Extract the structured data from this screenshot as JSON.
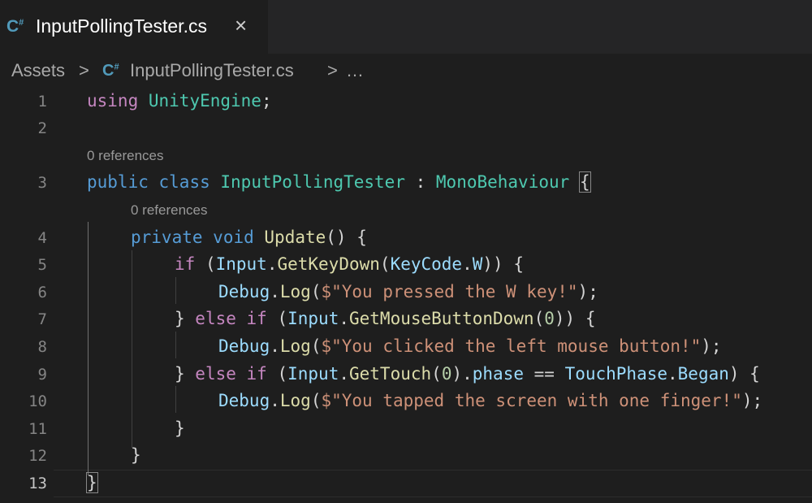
{
  "tab": {
    "icon": "csharp-icon",
    "title": "InputPollingTester.cs",
    "close": "×"
  },
  "breadcrumb": {
    "folder": "Assets",
    "sep1": ">",
    "file": "InputPollingTester.cs",
    "sep2": ">",
    "more": "…"
  },
  "editor": {
    "line_numbers": [
      "1",
      "2",
      "3",
      "4",
      "5",
      "6",
      "7",
      "8",
      "9",
      "10",
      "11",
      "12",
      "13"
    ],
    "active_line": "13",
    "codelens_class": "0 references",
    "codelens_method": "0 references",
    "code": {
      "l1_kw": "using",
      "l1_ns": "UnityEngine",
      "l1_semi": ";",
      "l3_public": "public",
      "l3_class": "class",
      "l3_name": "InputPollingTester",
      "l3_colon": " : ",
      "l3_base": "MonoBehaviour",
      "l3_brace": "{",
      "l4_private": "private",
      "l4_void": "void",
      "l4_method": "Update",
      "l4_rest": "() {",
      "l5_if": "if",
      "l5_open": " (",
      "l5_input": "Input",
      "l5_dot": ".",
      "l5_fn": "GetKeyDown",
      "l5_paren": "(",
      "l5_keycode": "KeyCode",
      "l5_dot2": ".",
      "l5_w": "W",
      "l5_close": ")) {",
      "l6_debug": "Debug",
      "l6_dot": ".",
      "l6_log": "Log",
      "l6_open": "(",
      "l6_str": "$\"You pressed the W key!\"",
      "l6_close": ");",
      "l7_brace": "} ",
      "l7_else": "else",
      "l7_sp": " ",
      "l7_if": "if",
      "l7_open": " (",
      "l7_input": "Input",
      "l7_dot": ".",
      "l7_fn": "GetMouseButtonDown",
      "l7_paren": "(",
      "l7_num": "0",
      "l7_close": ")) {",
      "l8_debug": "Debug",
      "l8_dot": ".",
      "l8_log": "Log",
      "l8_open": "(",
      "l8_str": "$\"You clicked the left mouse button!\"",
      "l8_close": ");",
      "l9_brace": "} ",
      "l9_else": "else",
      "l9_sp": " ",
      "l9_if": "if",
      "l9_open": " (",
      "l9_input": "Input",
      "l9_dot": ".",
      "l9_fn": "GetTouch",
      "l9_paren": "(",
      "l9_num": "0",
      "l9_rp": ").",
      "l9_phase": "phase",
      "l9_eq": " == ",
      "l9_tp": "TouchPhase",
      "l9_dot2": ".",
      "l9_began": "Began",
      "l9_close": ") {",
      "l10_debug": "Debug",
      "l10_dot": ".",
      "l10_log": "Log",
      "l10_open": "(",
      "l10_str": "$\"You tapped the screen with one finger!\"",
      "l10_close": ");",
      "l11": "}",
      "l12": "}",
      "l13": "}"
    }
  },
  "colors": {
    "background": "#1e1e1e",
    "keyword": "#c586c0",
    "storage": "#569cd6",
    "type": "#4ec9b0",
    "function": "#dcdcaa",
    "variable": "#9cdcfe",
    "string": "#ce9178",
    "number": "#b5cea8"
  }
}
